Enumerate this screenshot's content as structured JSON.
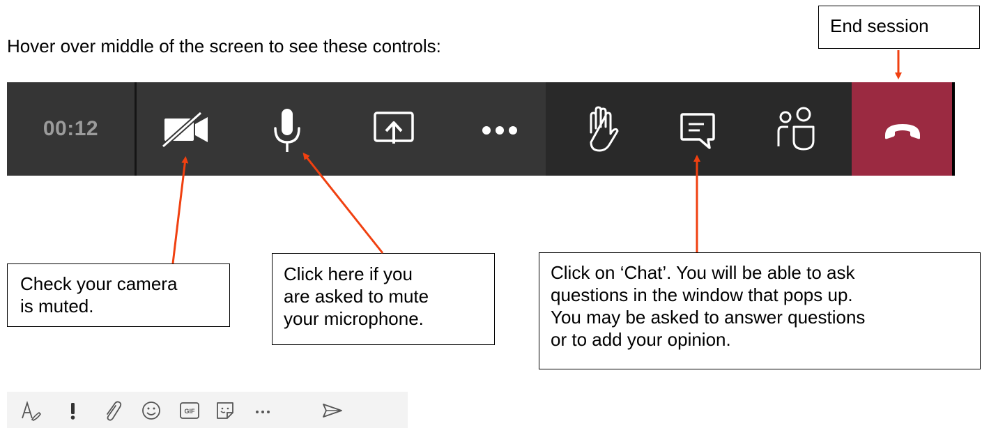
{
  "intro_text": "Hover over middle of the screen to see these controls:",
  "end_session_label": "End session",
  "call_controls": {
    "timer": "00:12",
    "buttons": [
      {
        "icon": "camera-off-icon"
      },
      {
        "icon": "microphone-icon"
      },
      {
        "icon": "share-screen-icon"
      },
      {
        "icon": "more-options-icon"
      },
      {
        "icon": "raise-hand-icon"
      },
      {
        "icon": "chat-icon"
      },
      {
        "icon": "participants-icon"
      },
      {
        "icon": "hang-up-icon"
      }
    ],
    "colors": {
      "bar_dark": "#292929",
      "bar_grey": "#363636",
      "hangup": "#9b2a41",
      "arrow": "#f04010"
    }
  },
  "callouts": {
    "camera": [
      "Check your camera",
      "is muted."
    ],
    "microphone": [
      "Click here if you",
      "are asked to mute",
      "your microphone."
    ],
    "chat": [
      "Click on ‘Chat’.  You will be able to ask",
      "questions in the window that pops up.",
      "You may be asked to answer questions",
      "or to add your opinion."
    ]
  },
  "compose_toolbar": {
    "icons": [
      "format-icon",
      "important-icon",
      "attach-icon",
      "emoji-icon",
      "gif-icon",
      "sticker-icon",
      "more-icon",
      "send-icon"
    ],
    "gif_label": "GIF"
  }
}
